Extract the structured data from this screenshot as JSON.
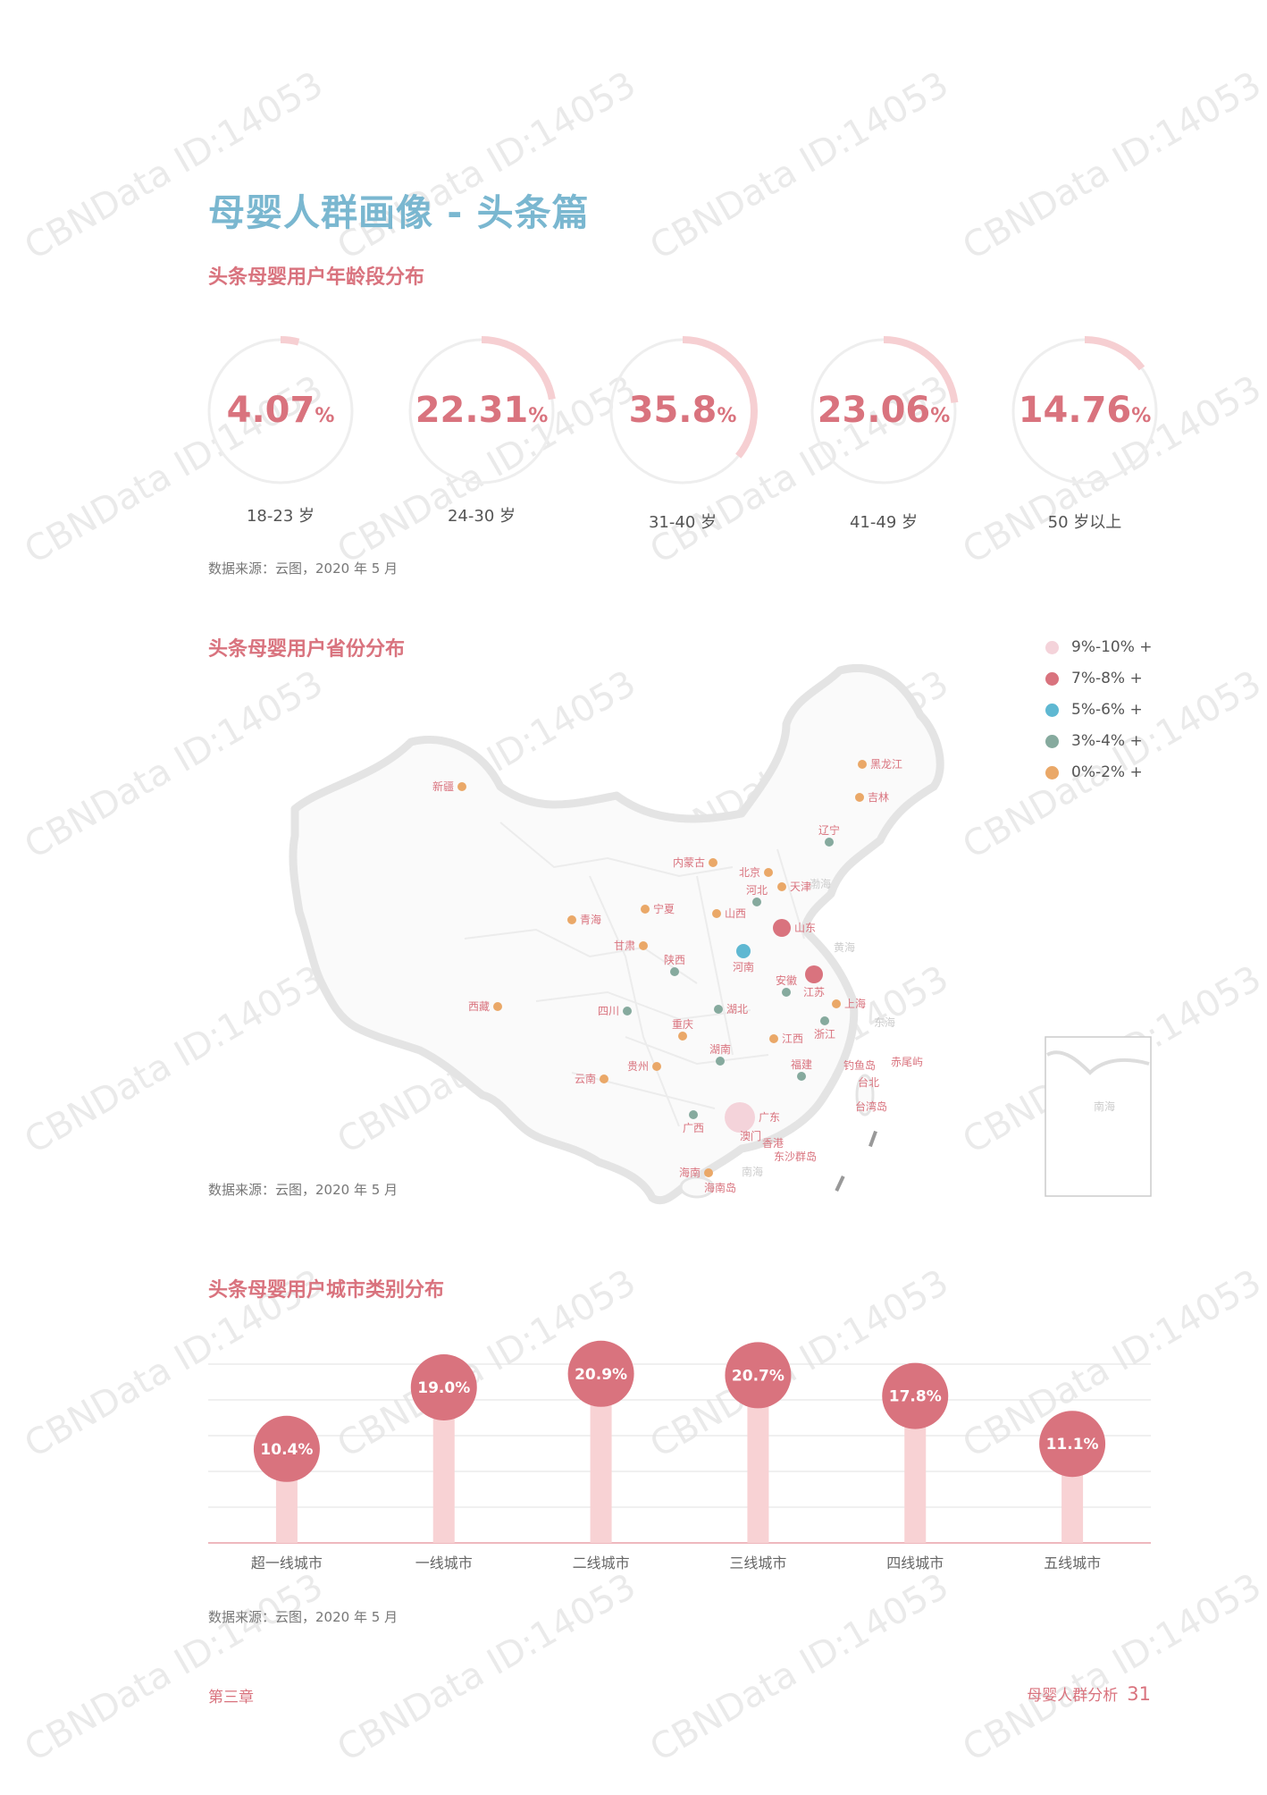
{
  "page_title": "母婴人群画像 - 头条篇",
  "watermark": "CBNData ID:14053",
  "colors": {
    "accent": "#d9737e",
    "title_blue": "#7ab7d0",
    "ring_track": "#eeeeee",
    "ring_fill": "#f6cfd2",
    "bar": "#f8d2d4",
    "bubble": "#d9737e"
  },
  "age_section": {
    "title": "头条母婴用户年龄段分布",
    "source": "数据来源：云图，2020 年 5 月",
    "items": [
      {
        "label": "18-23 岁",
        "num": "4.07",
        "pct_sign": "%",
        "value": 4.07
      },
      {
        "label": "24-30 岁",
        "num": "22.31",
        "pct_sign": "%",
        "value": 22.31
      },
      {
        "label": "31-40 岁",
        "num": "35.8",
        "pct_sign": "%",
        "value": 35.8
      },
      {
        "label": "41-49 岁",
        "num": "23.06",
        "pct_sign": "%",
        "value": 23.06
      },
      {
        "label": "50 岁以上",
        "num": "14.76",
        "pct_sign": "%",
        "value": 14.76
      }
    ]
  },
  "map_section": {
    "title": "头条母婴用户省份分布",
    "source": "数据来源：云图，2020 年 5 月",
    "legend": [
      {
        "label": "9%-10% +",
        "color": "#f4d3da"
      },
      {
        "label": "7%-8% +",
        "color": "#d9737e"
      },
      {
        "label": "5%-6% +",
        "color": "#5fb8d2"
      },
      {
        "label": "3%-4% +",
        "color": "#86aa9e"
      },
      {
        "label": "0%-2% +",
        "color": "#eaa868"
      }
    ],
    "provinces": [
      {
        "name": "新疆",
        "level": 4
      },
      {
        "name": "黑龙江",
        "level": 4
      },
      {
        "name": "吉林",
        "level": 4
      },
      {
        "name": "辽宁",
        "level": 3
      },
      {
        "name": "内蒙古",
        "level": 4
      },
      {
        "name": "北京",
        "level": 4
      },
      {
        "name": "天津",
        "level": 4
      },
      {
        "name": "河北",
        "level": 3
      },
      {
        "name": "青海",
        "level": 4
      },
      {
        "name": "宁夏",
        "level": 4
      },
      {
        "name": "山西",
        "level": 4
      },
      {
        "name": "山东",
        "level": 1
      },
      {
        "name": "甘肃",
        "level": 4
      },
      {
        "name": "陕西",
        "level": 3
      },
      {
        "name": "河南",
        "level": 2
      },
      {
        "name": "安徽",
        "level": 3
      },
      {
        "name": "江苏",
        "level": 1
      },
      {
        "name": "上海",
        "level": 4
      },
      {
        "name": "西藏",
        "level": 4
      },
      {
        "name": "四川",
        "level": 3
      },
      {
        "name": "湖北",
        "level": 3
      },
      {
        "name": "浙江",
        "level": 3
      },
      {
        "name": "重庆",
        "level": 4
      },
      {
        "name": "湖南",
        "level": 3
      },
      {
        "name": "江西",
        "level": 4
      },
      {
        "name": "贵州",
        "level": 4
      },
      {
        "name": "福建",
        "level": 3
      },
      {
        "name": "云南",
        "level": 4
      },
      {
        "name": "广西",
        "level": 3
      },
      {
        "name": "广东",
        "level": 0
      },
      {
        "name": "海南",
        "level": 4
      }
    ],
    "other_labels": [
      "黄海",
      "东海",
      "香港",
      "澳门",
      "台北",
      "台湾岛",
      "钓鱼岛",
      "赤尾屿",
      "东沙群岛",
      "南海",
      "海南岛",
      "渤海",
      "南海"
    ]
  },
  "city_section": {
    "title": "头条母婴用户城市类别分布",
    "source": "数据来源：云图，2020 年 5 月"
  },
  "chart_data": {
    "type": "bar",
    "categories": [
      "超一线城市",
      "一线城市",
      "二线城市",
      "三线城市",
      "四线城市",
      "五线城市"
    ],
    "values": [
      10.4,
      19.0,
      20.9,
      20.7,
      17.8,
      11.1
    ],
    "labels": [
      "10.4%",
      "19.0%",
      "20.9%",
      "20.7%",
      "17.8%",
      "11.1%"
    ],
    "title": "头条母婴用户城市类别分布",
    "xlabel": "",
    "ylabel": "",
    "ylim": [
      0,
      25
    ],
    "grid": true
  },
  "footer": {
    "chapter": "第三章",
    "report": "母婴人群分析",
    "page": "31"
  }
}
